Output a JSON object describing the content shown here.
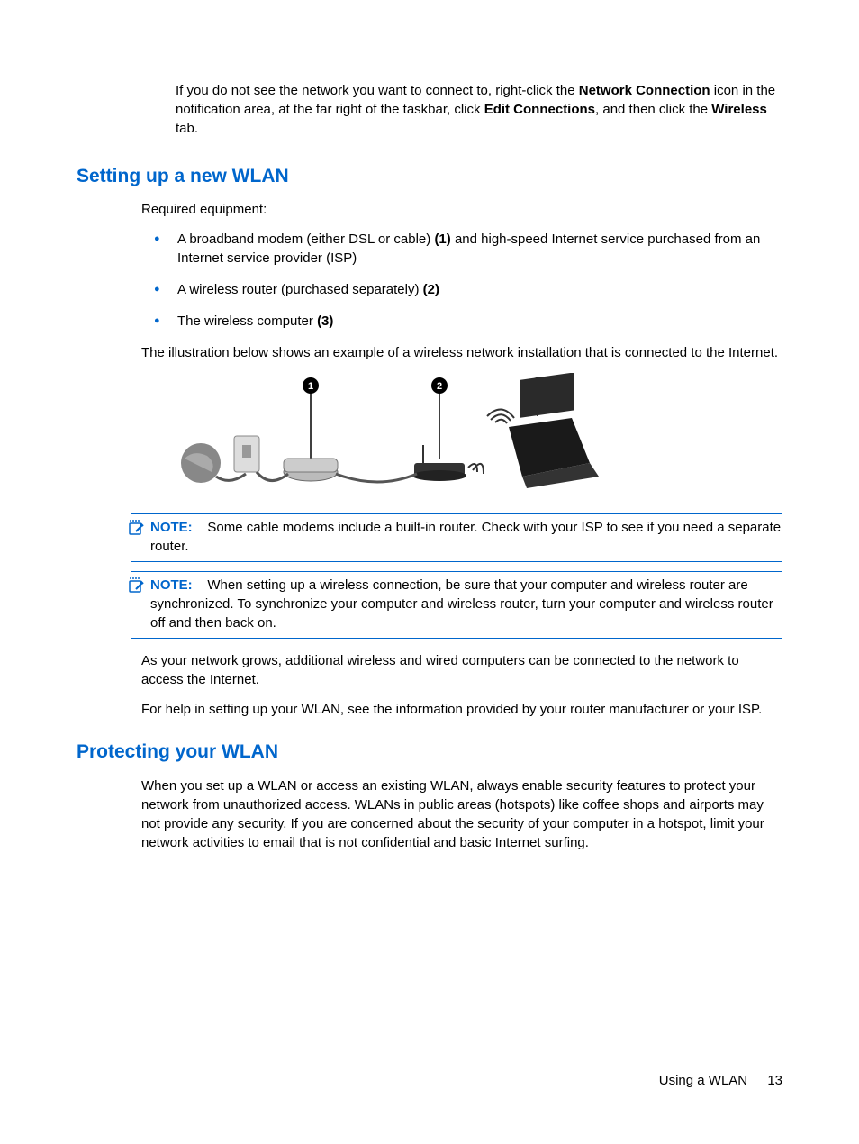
{
  "intro": {
    "pre": "If you do not see the network you want to connect to, right-click the ",
    "bold1": "Network Connection",
    "mid1": " icon in the notification area, at the far right of the taskbar, click ",
    "bold2": "Edit Connections",
    "mid2": ", and then click the ",
    "bold3": "Wireless",
    "post": " tab."
  },
  "section1": {
    "heading": "Setting up a new WLAN",
    "required_label": "Required equipment:",
    "bullets": [
      {
        "pre": "A broadband modem (either DSL or cable) ",
        "bold": "(1)",
        "post": " and high-speed Internet service purchased from an Internet service provider (ISP)"
      },
      {
        "pre": "A wireless router (purchased separately) ",
        "bold": "(2)",
        "post": ""
      },
      {
        "pre": "The wireless computer ",
        "bold": "(3)",
        "post": ""
      }
    ],
    "illustration_caption": "The illustration below shows an example of a wireless network installation that is connected to the Internet.",
    "note1": {
      "label": "NOTE:",
      "text": "Some cable modems include a built-in router. Check with your ISP to see if you need a separate router."
    },
    "note2": {
      "label": "NOTE:",
      "text": "When setting up a wireless connection, be sure that your computer and wireless router are synchronized. To synchronize your computer and wireless router, turn your computer and wireless router off and then back on."
    },
    "para_grow": "As your network grows, additional wireless and wired computers can be connected to the network to access the Internet.",
    "para_help": "For help in setting up your WLAN, see the information provided by your router manufacturer or your ISP."
  },
  "section2": {
    "heading": "Protecting your WLAN",
    "para": "When you set up a WLAN or access an existing WLAN, always enable security features to protect your network from unauthorized access. WLANs in public areas (hotspots) like coffee shops and airports may not provide any security. If you are concerned about the security of your computer in a hotspot, limit your network activities to email that is not confidential and basic Internet surfing."
  },
  "footer": {
    "title": "Using a WLAN",
    "page": "13"
  }
}
